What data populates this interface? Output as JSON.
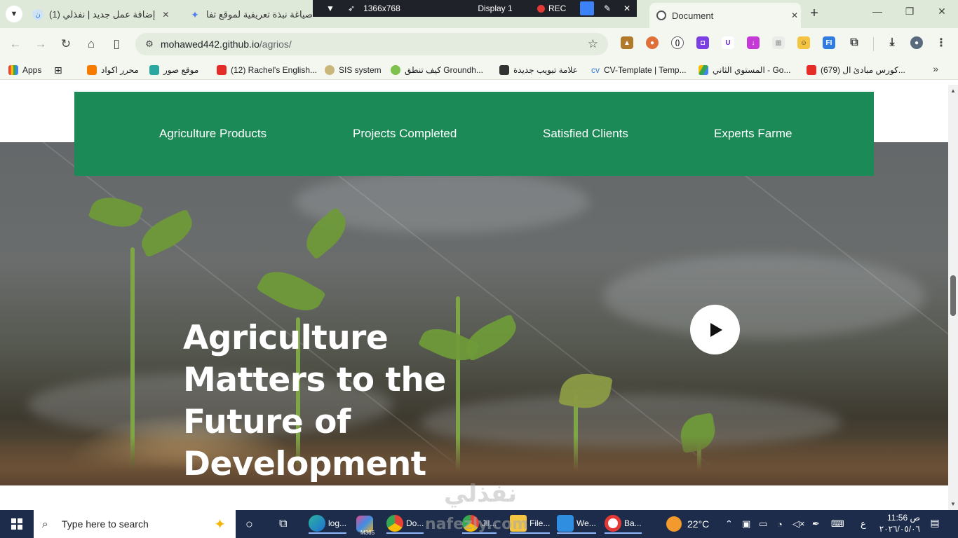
{
  "browser": {
    "tabs": [
      {
        "title": "(1) إضافة عمل جديد | نفذلي",
        "active": false
      },
      {
        "title": "صياغة نبذة تعريفية لموقع تفا",
        "active": false
      },
      {
        "title": "Document",
        "active": true
      }
    ],
    "address": {
      "host": "mohawed442.github.io",
      "path": "/agrios/"
    },
    "bookmarks": [
      {
        "label": "Apps"
      },
      {
        "label": "محرر اكواد"
      },
      {
        "label": "موقع صور"
      },
      {
        "label": "(12) Rachel's English..."
      },
      {
        "label": "SIS system"
      },
      {
        "label": "كيف تنطق Groundh..."
      },
      {
        "label": "علامة تبويب جديدة"
      },
      {
        "label": "CV-Template | Temp..."
      },
      {
        "label": "المستوي الثاني - Go..."
      },
      {
        "label": "(679) كورس مبادئ ال..."
      }
    ]
  },
  "recorder": {
    "resolution": "1366x768",
    "display": "Display 1",
    "rec": "REC"
  },
  "page": {
    "stats": [
      {
        "label": "Agriculture Products"
      },
      {
        "label": "Projects Completed"
      },
      {
        "label": "Satisfied Clients"
      },
      {
        "label": "Experts Farme"
      }
    ],
    "hero": {
      "lines": [
        "Agriculture",
        "Matters to the",
        "Future of",
        "Development"
      ]
    },
    "watermark": {
      "arabic": "نفذلي",
      "latin": "nafezly.com"
    }
  },
  "taskbar": {
    "search_placeholder": "Type here to search",
    "apps": [
      {
        "label": "log..."
      },
      {
        "label": "M365"
      },
      {
        "label": "Do..."
      },
      {
        "label": "Jll..."
      },
      {
        "label": "File..."
      },
      {
        "label": "We..."
      },
      {
        "label": "Ba..."
      }
    ],
    "weather": "22°C",
    "lang": "ع",
    "time": "11:56 ص",
    "date": "٢٠٢٦/٠٥/٠٦"
  }
}
